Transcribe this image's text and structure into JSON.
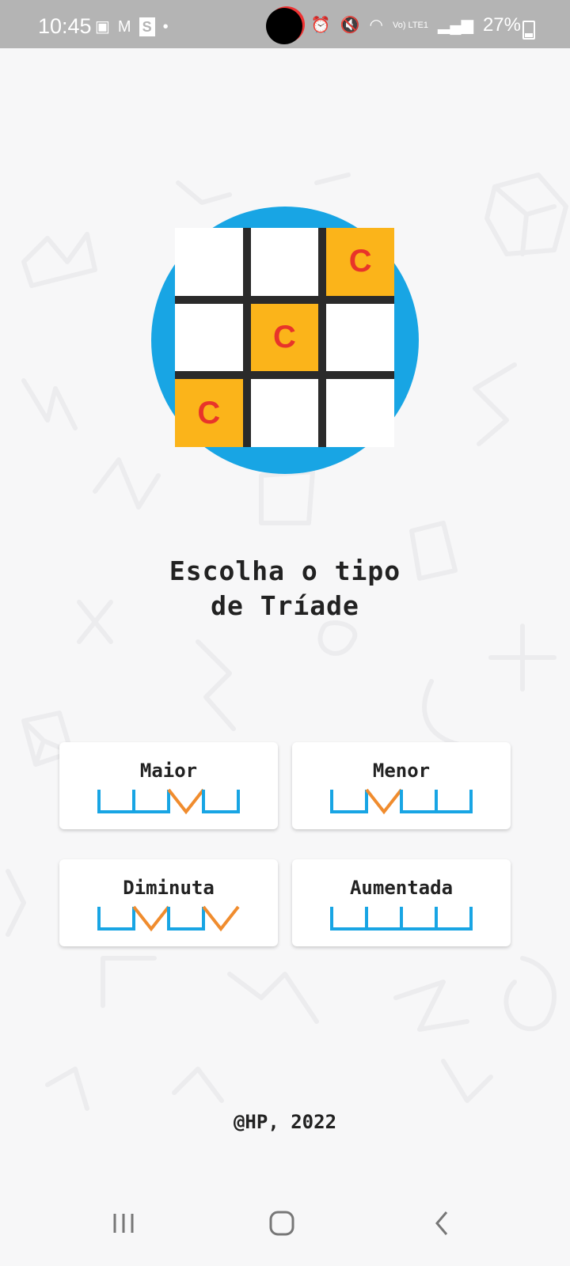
{
  "status": {
    "time": "10:45",
    "battery": "27%",
    "volte": "Vo) LTE1"
  },
  "logo": {
    "cells": [
      "",
      "",
      "C",
      "",
      "C",
      "",
      "C",
      "",
      ""
    ],
    "highlighted": [
      false,
      false,
      true,
      false,
      true,
      false,
      true,
      false,
      false
    ]
  },
  "title": {
    "line1": "Escolha o tipo",
    "line2": "de Tríade"
  },
  "options": [
    {
      "label": "Maior",
      "pattern": [
        "u",
        "u",
        "v",
        "u"
      ]
    },
    {
      "label": "Menor",
      "pattern": [
        "u",
        "v",
        "u",
        "u"
      ]
    },
    {
      "label": "Diminuta",
      "pattern": [
        "u",
        "v",
        "u",
        "v"
      ]
    },
    {
      "label": "Aumentada",
      "pattern": [
        "u",
        "u",
        "u",
        "u"
      ]
    }
  ],
  "footer": {
    "credit": "@HP, 2022"
  },
  "colors": {
    "blue": "#18a5e4",
    "orange": "#f08c2e",
    "yellow": "#fbb41a",
    "red": "#e8342a"
  }
}
